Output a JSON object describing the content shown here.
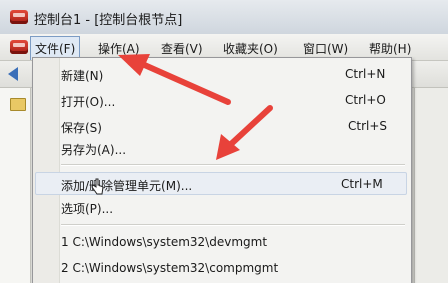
{
  "window": {
    "title": "控制台1 - [控制台根节点]"
  },
  "menubar": {
    "items": [
      {
        "label": "文件(F)"
      },
      {
        "label": "操作(A)"
      },
      {
        "label": "查看(V)"
      },
      {
        "label": "收藏夹(O)"
      },
      {
        "label": "窗口(W)"
      },
      {
        "label": "帮助(H)"
      }
    ]
  },
  "file_menu": {
    "items": [
      {
        "label": "新建(N)",
        "shortcut": "Ctrl+N"
      },
      {
        "label": "打开(O)...",
        "shortcut": "Ctrl+O"
      },
      {
        "label": "保存(S)",
        "shortcut": "Ctrl+S"
      },
      {
        "label": "另存为(A)...",
        "shortcut": ""
      },
      {
        "label": "添加/删除管理单元(M)...",
        "shortcut": "Ctrl+M"
      },
      {
        "label": "选项(P)...",
        "shortcut": ""
      },
      {
        "label": "1 C:\\Windows\\system32\\devmgmt",
        "shortcut": ""
      },
      {
        "label": "2 C:\\Windows\\system32\\compmgmt",
        "shortcut": ""
      }
    ],
    "highlighted_item": "添加/删除管理单元(M)..."
  },
  "annotations": {
    "arrow_color": "#e8423a"
  },
  "icons": {
    "app_icon": "console-icon",
    "menu_icon": "console-icon",
    "back": "back-arrow-icon",
    "tree": "folder-icon",
    "cursor": "mouse-cursor-icon"
  }
}
